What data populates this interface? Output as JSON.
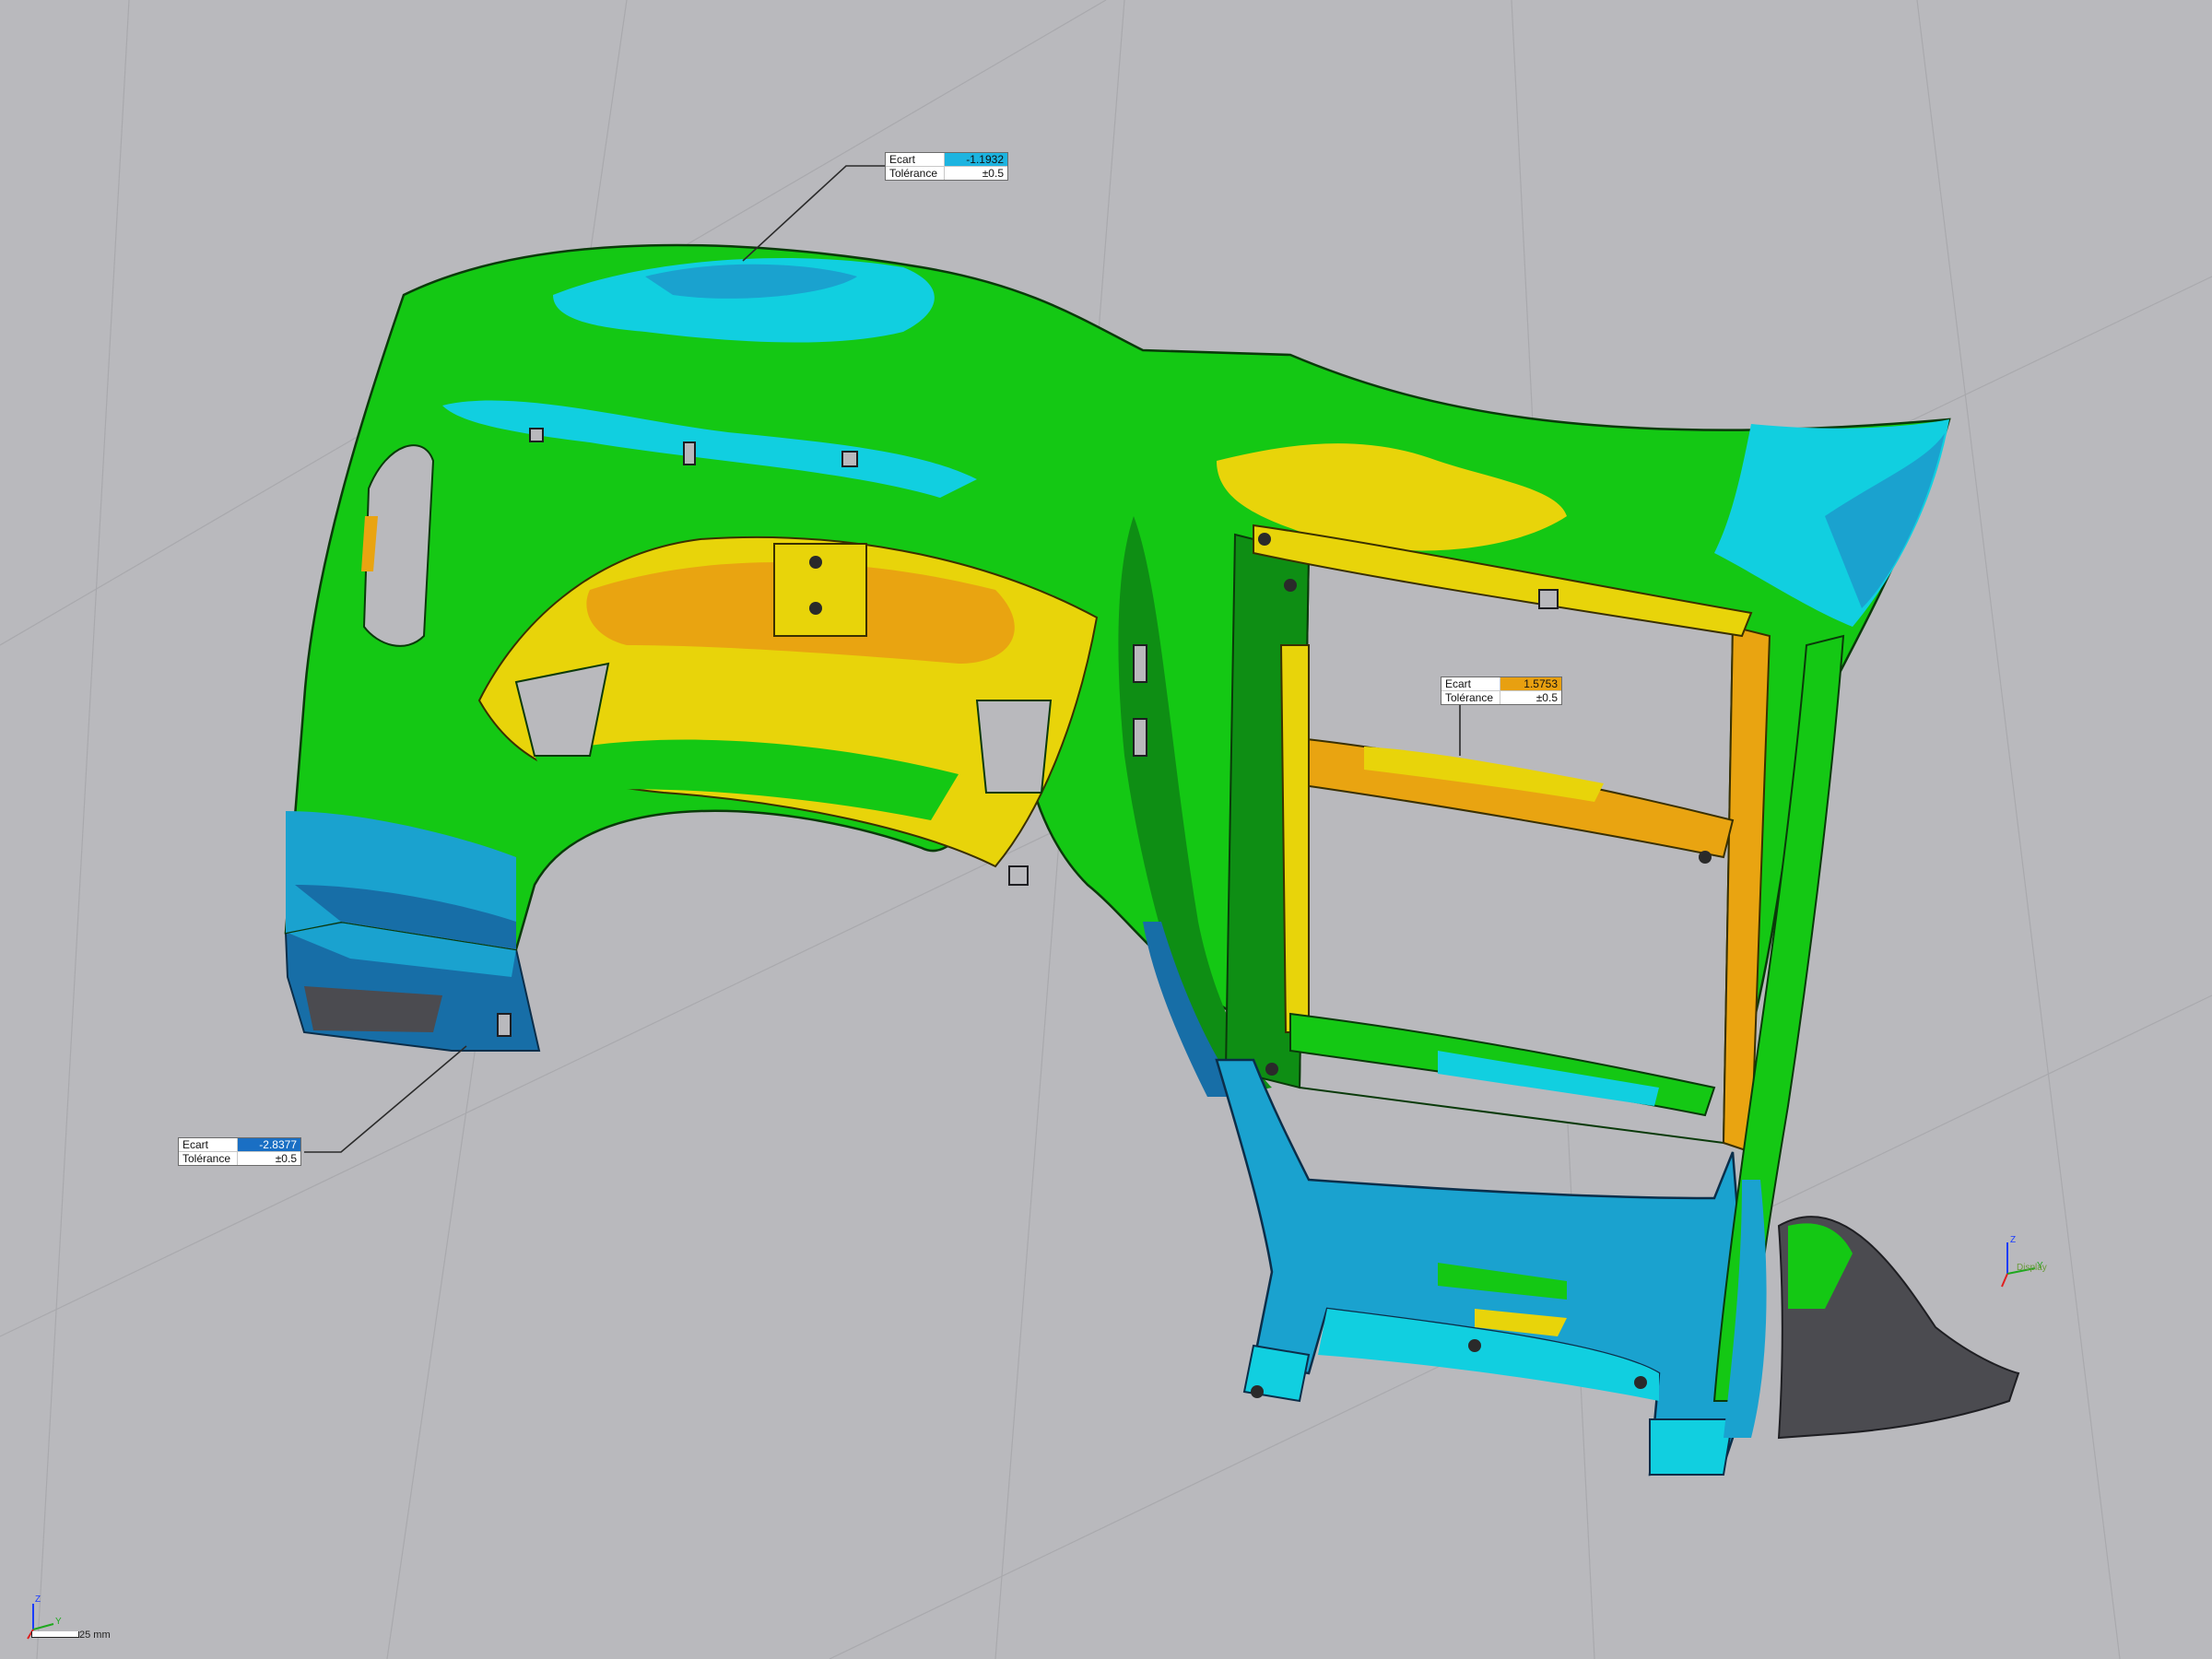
{
  "colors": {
    "background": "#b9b9bd",
    "in_tolerance": "#14c814",
    "minus_light": "#11cfe0",
    "minus_mid": "#1aa2cf",
    "minus_dark": "#176ea7",
    "plus_light": "#e8d40a",
    "plus_mid": "#e9a411",
    "no_data": "#4b4b50"
  },
  "callouts": [
    {
      "deviation_label": "Ecart",
      "deviation_value": "-1.1932",
      "deviation_color": "#1db4e0",
      "tolerance_label": "Tolérance",
      "tolerance_value": "±0.5"
    },
    {
      "deviation_label": "Ecart",
      "deviation_value": "1.5753",
      "deviation_color": "#e8a010",
      "tolerance_label": "Tolérance",
      "tolerance_value": "±0.5"
    },
    {
      "deviation_label": "Ecart",
      "deviation_value": "-2.8377",
      "deviation_color": "#1a6fc4",
      "tolerance_label": "Tolérance",
      "tolerance_value": "±0.5"
    }
  ],
  "triad_right": {
    "z": "Z",
    "y": "Y",
    "label": "Display"
  },
  "triad_left": {
    "z": "Z",
    "y": "Y"
  },
  "scale": {
    "label": "25 mm"
  },
  "icons": [
    "axis-triad-icon",
    "scale-bar-icon"
  ]
}
